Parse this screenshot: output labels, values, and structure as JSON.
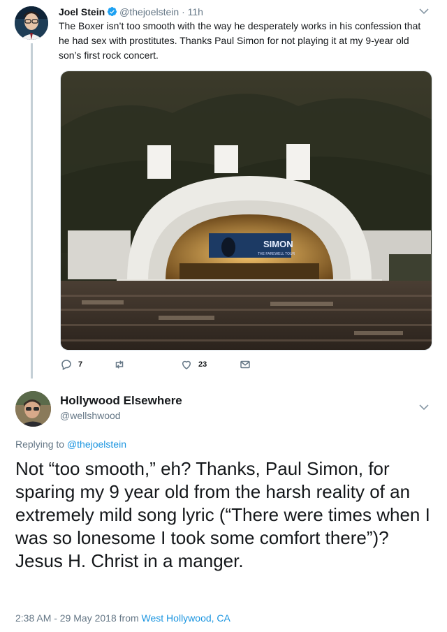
{
  "parent_tweet": {
    "name": "Joel Stein",
    "handle": "@thejoelstein",
    "separator": "·",
    "time": "11h",
    "text": "The Boxer isn’t too smooth with the way he desperately works in his confession that he had sex with prostitutes. Thanks Paul Simon for not playing it at my 9-year old son’s first rock concert.",
    "photo_screen_text": "SIMON",
    "photo_screen_subtext": "THE FAREWELL TOUR",
    "replies_count": "7",
    "retweets_count": "",
    "likes_count": "23"
  },
  "reply_tweet": {
    "name": "Hollywood Elsewhere",
    "handle": "@wellshwood",
    "replying_prefix": "Replying to",
    "replying_handle": "@thejoelstein",
    "text": "Not “too smooth,” eh?  Thanks, Paul Simon, for sparing my 9 year old from the harsh reality of an extremely mild song lyric (“There were times when I was so lonesome I took some comfort there”)?  Jesus H. Christ in a manger.",
    "timestamp": "2:38 AM - 29 May 2018 from",
    "location": "West Hollywood, CA"
  },
  "colors": {
    "link_blue": "#1b95e0",
    "muted_gray": "#657786",
    "text_dark": "#14171a",
    "thread_line": "#c4cfd6"
  },
  "icons": [
    "verified-badge-icon",
    "chevron-down-icon",
    "reply-icon",
    "retweet-icon",
    "like-icon",
    "direct-message-icon"
  ]
}
